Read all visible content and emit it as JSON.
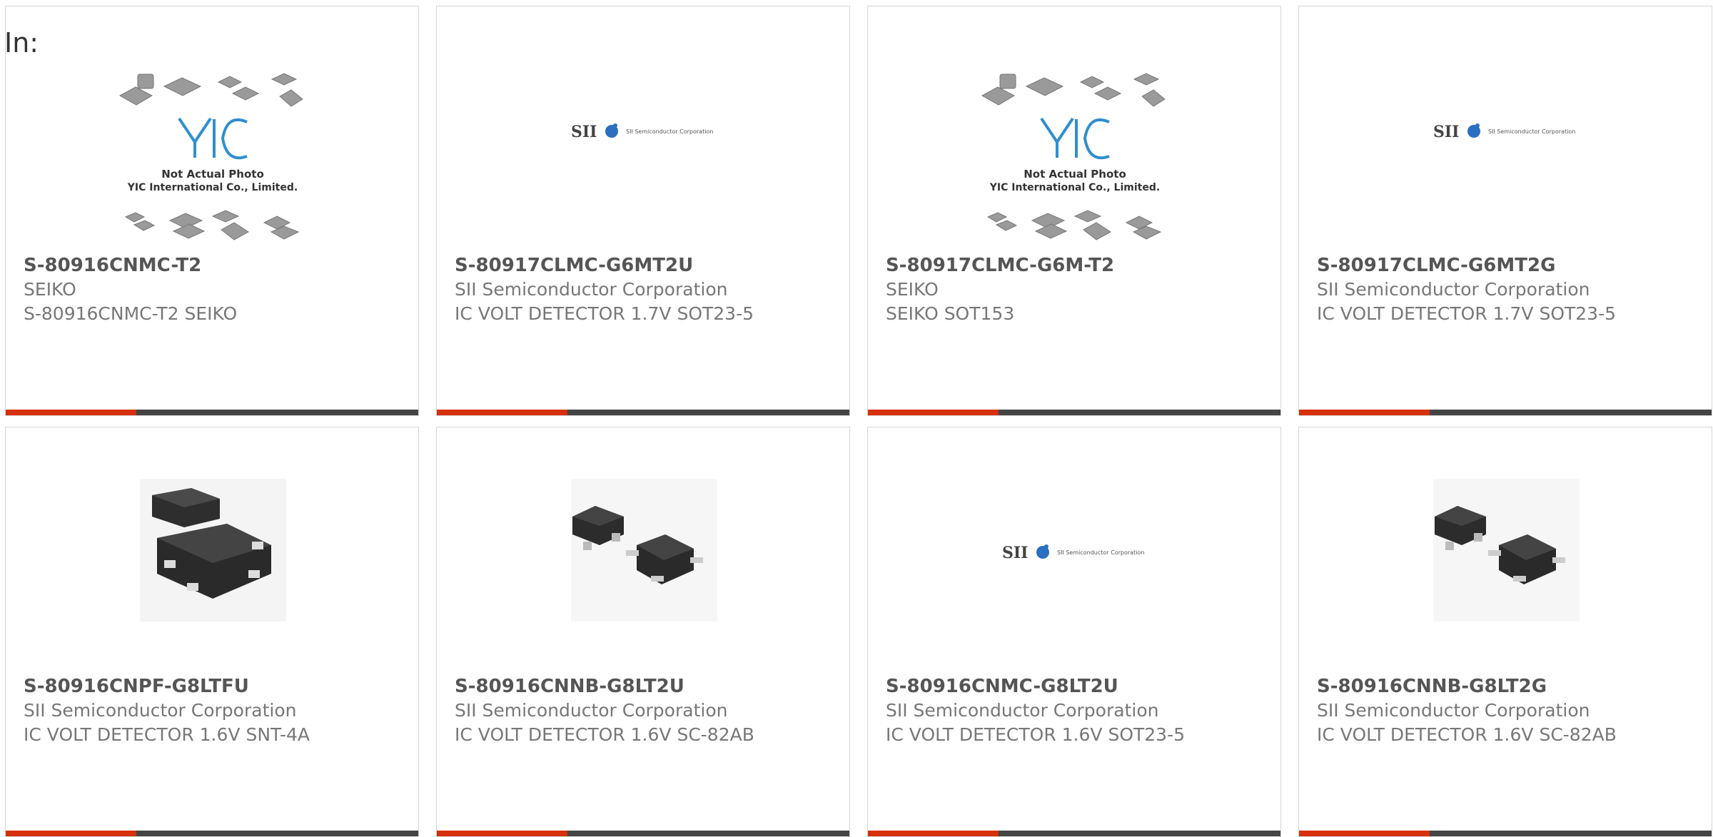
{
  "heading": "In:",
  "colors": {
    "accent": "#d6300d",
    "bar": "#444444",
    "border": "#d6d6d6"
  },
  "products": [
    {
      "part": "S-80916CNMC-T2",
      "mfr": "SEIKO",
      "desc": "S-80916CNMC-T2 SEIKO",
      "image": "yic-placeholder-icon",
      "placeholder": {
        "line1": "Not Actual Photo",
        "line2": "YIC International Co., Limited."
      }
    },
    {
      "part": "S-80917CLMC-G6MT2U",
      "mfr": "SII Semiconductor Corporation",
      "desc": "IC VOLT DETECTOR 1.7V SOT23-5",
      "image": "sii-logo-icon",
      "logo": {
        "mark": "SII",
        "sub": "SII Semiconductor Corporation"
      }
    },
    {
      "part": "S-80917CLMC-G6M-T2",
      "mfr": "SEIKO",
      "desc": "SEIKO SOT153",
      "image": "yic-placeholder-icon",
      "placeholder": {
        "line1": "Not Actual Photo",
        "line2": "YIC International Co., Limited."
      }
    },
    {
      "part": "S-80917CLMC-G6MT2G",
      "mfr": "SII Semiconductor Corporation",
      "desc": "IC VOLT DETECTOR 1.7V SOT23-5",
      "image": "sii-logo-icon",
      "logo": {
        "mark": "SII",
        "sub": "SII Semiconductor Corporation"
      }
    },
    {
      "part": "S-80916CNPF-G8LTFU",
      "mfr": "SII Semiconductor Corporation",
      "desc": "IC VOLT DETECTOR 1.6V SNT-4A",
      "image": "snt-chip-icon"
    },
    {
      "part": "S-80916CNNB-G8LT2U",
      "mfr": "SII Semiconductor Corporation",
      "desc": "IC VOLT DETECTOR 1.6V SC-82AB",
      "image": "sc82-chip-icon"
    },
    {
      "part": "S-80916CNMC-G8LT2U",
      "mfr": "SII Semiconductor Corporation",
      "desc": "IC VOLT DETECTOR 1.6V SOT23-5",
      "image": "sii-logo-icon",
      "logo": {
        "mark": "SII",
        "sub": "SII Semiconductor Corporation"
      }
    },
    {
      "part": "S-80916CNNB-G8LT2G",
      "mfr": "SII Semiconductor Corporation",
      "desc": "IC VOLT DETECTOR 1.6V SC-82AB",
      "image": "sc82-chip-icon"
    }
  ]
}
